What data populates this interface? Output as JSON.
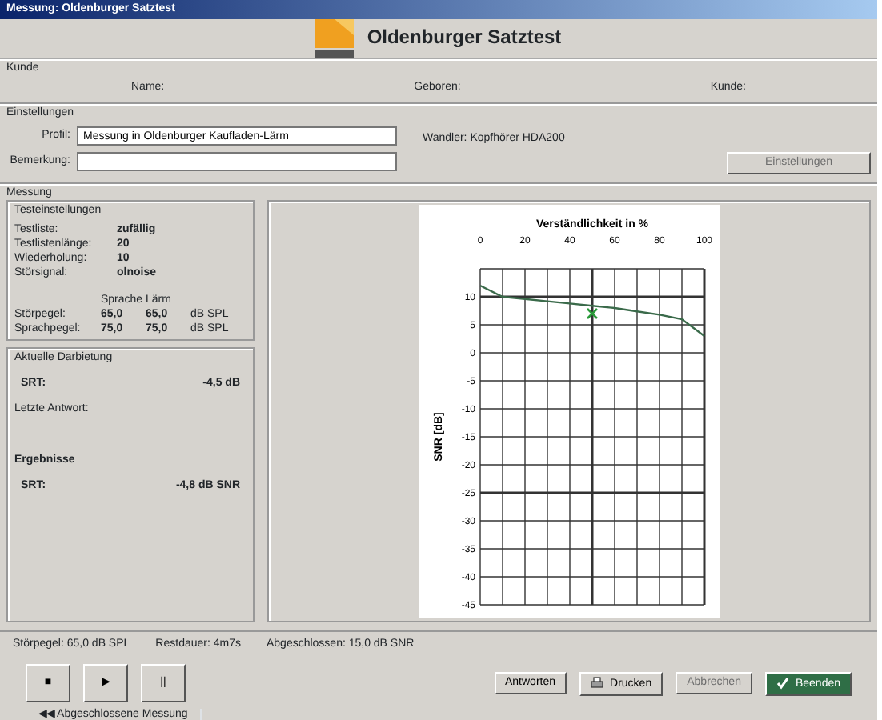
{
  "window": {
    "title": "Messung: Oldenburger Satztest"
  },
  "header": {
    "title": "Oldenburger Satztest"
  },
  "customer": {
    "heading": "Kunde",
    "fields": [
      "Name:",
      "Geboren:",
      "Kunde:"
    ]
  },
  "settings": {
    "heading": "Einstellungen",
    "profile_label": "Profil:",
    "profile_value": "Messung in Oldenburger Kaufladen-Lärm",
    "remark_label": "Bemerkung:",
    "output": "Wandler: Kopfhörer HDA200",
    "button": {
      "label": "Einstellungen",
      "disabled": true
    }
  },
  "measurement": {
    "heading": "Messung",
    "test_settings": {
      "heading": "Testeinstellungen",
      "rows": [
        {
          "label": "Testliste:",
          "value": "zufällig"
        },
        {
          "label": "Testlistenlänge:",
          "value": "20"
        },
        {
          "label": "Wiederholung:",
          "value": "10"
        },
        {
          "label": "Störsignal:",
          "value": "olnoise"
        }
      ],
      "columns": [
        "Sprache",
        "Lärm"
      ],
      "levels": [
        {
          "label": "Störpegel:",
          "speech": "65,0",
          "noise": "65,0",
          "unit": "dB SPL"
        },
        {
          "label": "Sprachpegel:",
          "speech": "75,0",
          "noise": "75,0",
          "unit": "dB SPL"
        }
      ]
    },
    "current": {
      "heading": "Aktuelle Darbietung",
      "srt_label": "SRT:",
      "srt_value": "-4,5 dB",
      "last_answer": "Letzte Antwort:",
      "results_heading": "Ergebnisse",
      "result_label": "SRT:",
      "result_value": "-4,8 dB SNR"
    },
    "chart_data": {
      "type": "line",
      "title": "Verständlichkeit in %",
      "ylabel": "SNR [dB]",
      "x": [
        0,
        10,
        20,
        30,
        40,
        50,
        60,
        70,
        80,
        90,
        100
      ],
      "grid": true,
      "series": [
        {
          "color": "#3a6a4a",
          "values": [
            12,
            10,
            9.6,
            9.2,
            8.8,
            8.4,
            8,
            7.4,
            6.8,
            6,
            3
          ]
        },
        {
          "color": "#2a9a3a",
          "marker": "x",
          "values": [
            null,
            null,
            null,
            null,
            null,
            7,
            null,
            null,
            null,
            null,
            null
          ]
        }
      ],
      "xlim": [
        0,
        100
      ],
      "ylim": [
        -45,
        15
      ],
      "xticks": [
        0,
        20,
        40,
        60,
        80,
        100
      ],
      "yticks": [
        10,
        5,
        0,
        -5,
        -10,
        -15,
        -20,
        -25,
        -30,
        -35,
        -40,
        -45
      ]
    }
  },
  "status": [
    "Störpegel: 65,0 dB SPL",
    "Restdauer: 4m7s",
    "Abgeschlossen: 15,0 dB SNR"
  ],
  "controls": [
    {
      "label": "■"
    },
    {
      "label": "▶"
    },
    {
      "label": "||"
    }
  ],
  "actions": [
    {
      "label": "Antworten",
      "kind": "plain",
      "disabled": false
    },
    {
      "label": "Drucken",
      "kind": "print",
      "disabled": false
    },
    {
      "label": "Abbrechen",
      "kind": "plain",
      "disabled": true
    },
    {
      "label": "Beenden",
      "kind": "ok",
      "disabled": false
    }
  ],
  "bottom_tab": "◀◀ Abgeschlossene Messung"
}
